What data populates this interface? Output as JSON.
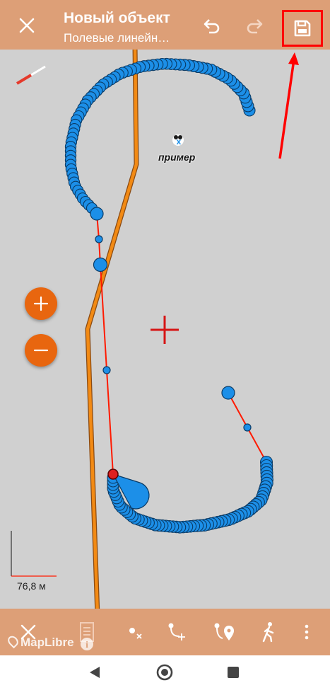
{
  "header": {
    "title": "Новый объект",
    "subtitle": "Полевые линейн…",
    "bg_color": "#dd9f77"
  },
  "map": {
    "bg_color": "#d0d0d0",
    "poi_label": "пример",
    "scale_label": "76,8 м",
    "attribution": "MapLibre",
    "track_color": "#ff1a00",
    "point_color": "#1c8fe8",
    "road_color": "#f28a14"
  },
  "icons": {
    "close": "close-icon",
    "undo": "undo-icon",
    "redo": "redo-icon",
    "save": "save-icon",
    "zoom_in": "plus-icon",
    "zoom_out": "minus-icon"
  },
  "annotation": {
    "highlight_color": "#ff0000"
  }
}
